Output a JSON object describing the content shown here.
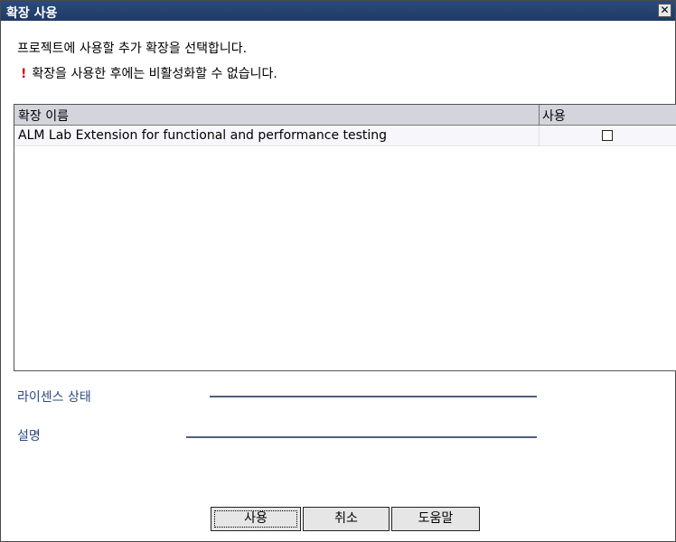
{
  "dialog": {
    "title": "확장 사용",
    "close_icon": "x-close-icon",
    "intro_text": "프로젝트에 사용할 추가 확장을 선택합니다.",
    "warning_icon": "exclamation-icon",
    "warning_mark": "!",
    "warning_text": "확장을 사용한 후에는 비활성화할 수 없습니다."
  },
  "table": {
    "headers": [
      "확장 이름",
      "사용"
    ],
    "rows": [
      {
        "name": "ALM Lab Extension for functional and performance testing",
        "enabled": false
      }
    ]
  },
  "details": {
    "license_label": "라이센스 상태",
    "description_label": "설명"
  },
  "buttons": {
    "use": "사용",
    "cancel": "취소",
    "help": "도움말"
  }
}
